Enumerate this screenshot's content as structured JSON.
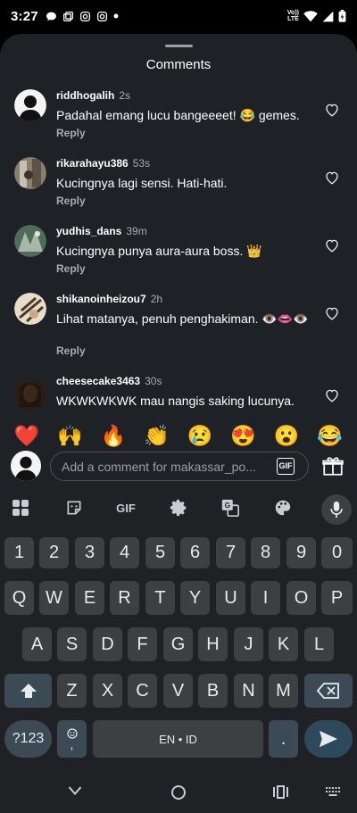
{
  "status_bar": {
    "time": "3:27",
    "network_top": "Vo))",
    "network_bottom": "LTE"
  },
  "sheet": {
    "title": "Comments"
  },
  "comments": [
    {
      "username": "riddhogalih",
      "time": "2s",
      "text": "Padahal emang lucu bangeeeet! 😂 gemes.",
      "reply": "Reply"
    },
    {
      "username": "rikarahayu386",
      "time": "53s",
      "text": "Kucingnya lagi sensi. Hati-hati.",
      "reply": "Reply"
    },
    {
      "username": "yudhis_dans",
      "time": "39m",
      "text": "Kucingnya punya aura-aura boss. 👑",
      "reply": "Reply"
    },
    {
      "username": "shikanoinheizou7",
      "time": "2h",
      "text": "Lihat matanya, penuh penghakiman. 👁️👄👁️",
      "reply": "Reply"
    },
    {
      "username": "cheesecake3463",
      "time": "30s",
      "text": "WKWKWKWK mau nangis saking lucunya.",
      "reply": ""
    }
  ],
  "emoji_reactions": [
    "❤️",
    "🙌",
    "🔥",
    "👏",
    "😢",
    "😍",
    "😮",
    "😂"
  ],
  "comment_input": {
    "placeholder": "Add a comment for makassar_po...",
    "gif_label": "GIF"
  },
  "keyboard": {
    "toolbar_gif": "GIF",
    "row_numbers": [
      "1",
      "2",
      "3",
      "4",
      "5",
      "6",
      "7",
      "8",
      "9",
      "0"
    ],
    "row_1": [
      "Q",
      "W",
      "E",
      "R",
      "T",
      "Y",
      "U",
      "I",
      "O",
      "P"
    ],
    "row_2": [
      "A",
      "S",
      "D",
      "F",
      "G",
      "H",
      "J",
      "K",
      "L"
    ],
    "row_3": [
      "Z",
      "X",
      "C",
      "V",
      "B",
      "N",
      "M"
    ],
    "symbols_label": "?123",
    "comma_label": ",",
    "space_label": "EN • ID",
    "period_label": "."
  },
  "colors": {
    "sheet_bg": "#1e2126",
    "keyboard_bg": "#202124",
    "key_bg": "#3c4043",
    "enter_key_bg": "#2d4a5c"
  }
}
